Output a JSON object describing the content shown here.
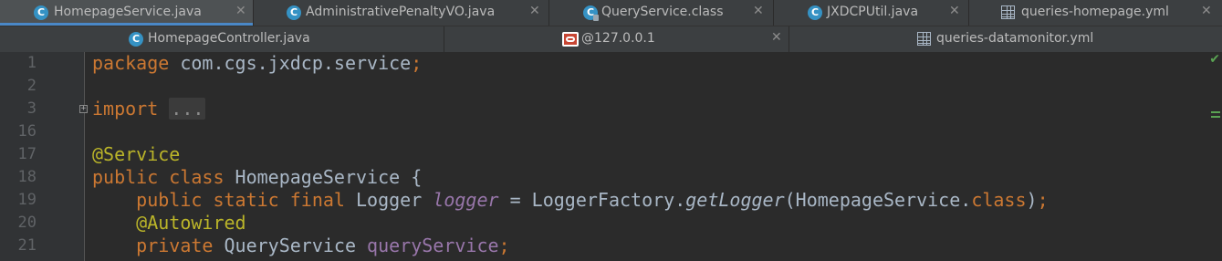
{
  "tabs_row1": [
    {
      "label": "HomepageService.java",
      "icon": "class-c-icon",
      "active": true
    },
    {
      "label": "AdministrativePenaltyVO.java",
      "icon": "class-c-icon",
      "active": false
    },
    {
      "label": "QueryService.class",
      "icon": "locked-class-icon",
      "active": false
    },
    {
      "label": "JXDCPUtil.java",
      "icon": "class-c-icon",
      "active": false
    },
    {
      "label": "queries-homepage.yml",
      "icon": "table-icon",
      "active": false
    }
  ],
  "tabs_row2": [
    {
      "label": "HomepageController.java",
      "icon": "class-c-icon"
    },
    {
      "label": "@127.0.0.1",
      "icon": "oracle-icon"
    },
    {
      "label": "queries-datamonitor.yml",
      "icon": "table-icon"
    }
  ],
  "close_glyph": "✕",
  "class_icon_letter": "C",
  "fold_glyph": "+",
  "check_glyph": "✔",
  "line_numbers": [
    "1",
    "2",
    "3",
    "16",
    "17",
    "18",
    "19",
    "20",
    "21"
  ],
  "code": {
    "l1_kw": "package",
    "l1_rest": " com.cgs.jxdcp.service",
    "l1_semi": ";",
    "l3_kw": "import",
    "l3_sp": " ",
    "l3_fold": "...",
    "l17_ann": "@Service",
    "l18_kw": "public class",
    "l18_rest": " HomepageService {",
    "l19_indent": "    ",
    "l19_kw": "public static final",
    "l19_type": " Logger ",
    "l19_field": "logger",
    "l19_eq": " = LoggerFactory.",
    "l19_method": "getLogger",
    "l19_arg": "(HomepageService.",
    "l19_class_kw": "class",
    "l19_end": ")",
    "l19_semi": ";",
    "l20_indent": "    ",
    "l20_ann": "@Autowired",
    "l21_indent": "    ",
    "l21_kw": "private",
    "l21_type": " QueryService ",
    "l21_field": "queryService",
    "l21_semi": ";"
  },
  "colors": {
    "keyword": "#cc7832",
    "annotation": "#bbb529",
    "field": "#9876aa",
    "text": "#a9b7c6",
    "tab_accent": "#4a88c7",
    "ok": "#5aa353"
  }
}
